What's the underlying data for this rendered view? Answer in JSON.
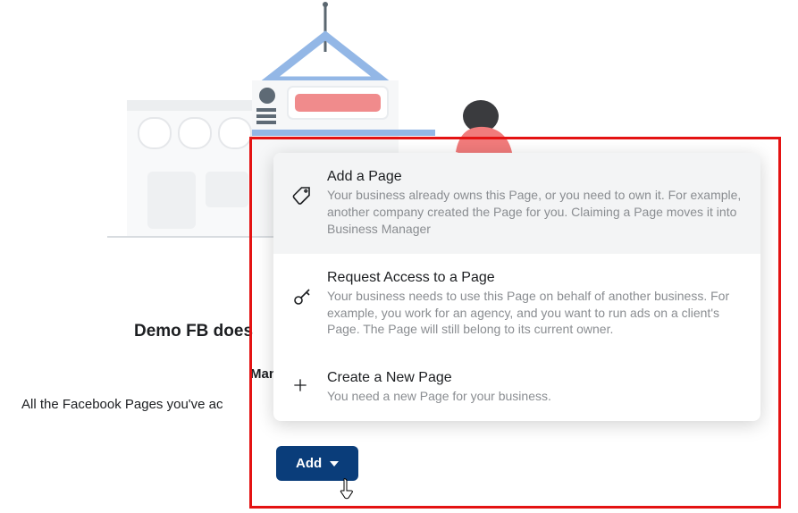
{
  "heading": "Demo FB does",
  "subheading": "Man",
  "description": "All the Facebook Pages you've ac",
  "dropdown": {
    "items": [
      {
        "title": "Add a Page",
        "desc": "Your business already owns this Page, or you need to own it. For example, another company created the Page for you. Claiming a Page moves it into Business Manager"
      },
      {
        "title": "Request Access to a Page",
        "desc": "Your business needs to use this Page on behalf of another business. For example, you work for an agency, and you want to run ads on a client's Page. The Page will still belong to its current owner."
      },
      {
        "title": "Create a New Page",
        "desc": "You need a new Page for your business."
      }
    ]
  },
  "add_button": "Add"
}
